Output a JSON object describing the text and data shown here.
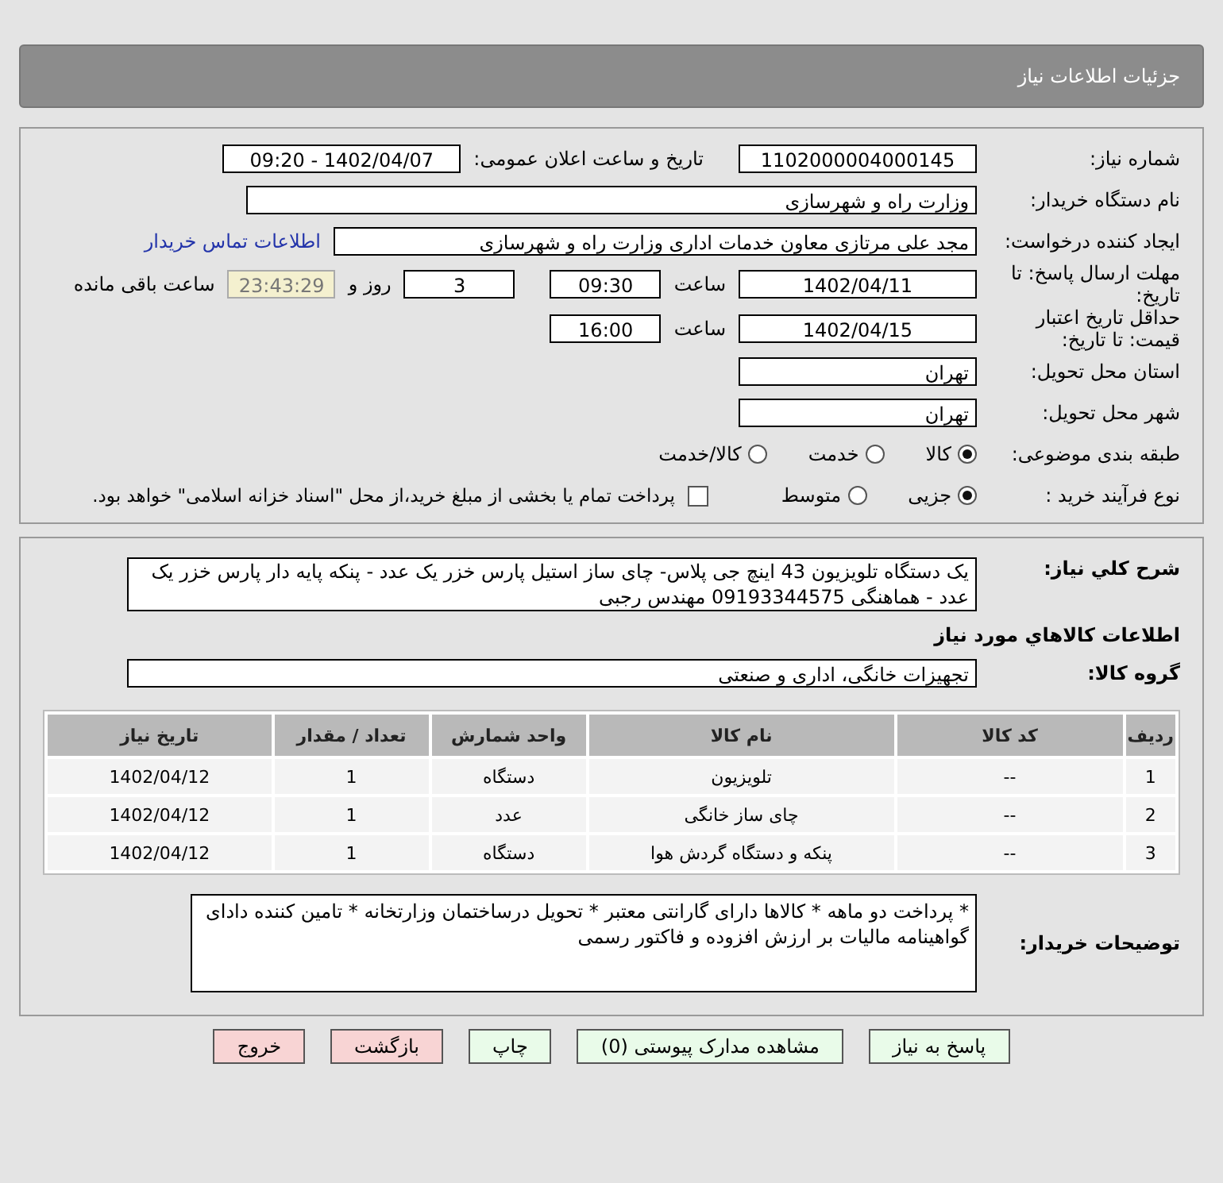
{
  "page_title": "جزئیات اطلاعات نیاز",
  "form": {
    "need_number": {
      "label": "شماره نیاز:",
      "value": "1102000004000145"
    },
    "announce": {
      "label": "تاریخ و ساعت اعلان عمومی:",
      "value": "1402/04/07 - 09:20"
    },
    "buyer": {
      "label": "نام دستگاه خریدار:",
      "value": "وزارت راه و شهرسازی"
    },
    "requester": {
      "label": "ایجاد کننده درخواست:",
      "value": "مجد علی  مرتازی معاون خدمات اداری وزارت راه و شهرسازی",
      "link": "اطلاعات تماس خریدار"
    },
    "deadline": {
      "label": "مهلت ارسال پاسخ: تا تاریخ:",
      "date": "1402/04/11",
      "time_label": "ساعت",
      "time": "09:30",
      "days": "3",
      "days_label": "روز و",
      "remaining": "23:43:29",
      "remaining_label": "ساعت باقی مانده"
    },
    "validity": {
      "label": "حداقل تاریخ اعتبار قیمت: تا تاریخ:",
      "date": "1402/04/15",
      "time_label": "ساعت",
      "time": "16:00"
    },
    "province": {
      "label": "استان محل تحویل:",
      "value": "تهران"
    },
    "city": {
      "label": "شهر محل تحویل:",
      "value": "تهران"
    },
    "category": {
      "label": "طبقه بندی موضوعی:",
      "options": [
        {
          "label": "کالا",
          "selected": true
        },
        {
          "label": "خدمت",
          "selected": false
        },
        {
          "label": "کالا/خدمت",
          "selected": false
        }
      ]
    },
    "process": {
      "label": "نوع فرآیند خرید :",
      "options": [
        {
          "label": "جزیی",
          "selected": true
        },
        {
          "label": "متوسط",
          "selected": false
        }
      ],
      "payment": {
        "checked": false,
        "text": "پرداخت تمام یا بخشی از مبلغ خرید،از محل \"اسناد خزانه اسلامی\" خواهد بود."
      }
    }
  },
  "summary": {
    "description": {
      "label": "شرح کلي نیاز:",
      "value": "یک دستگاه تلویزیون 43 اینچ جی پلاس- چای ساز استیل پارس خزر یک عدد - پنکه پایه دار پارس خزر یک عدد - هماهنگی 09193344575 مهندس رجبی"
    },
    "goods_heading": "اطلاعات کالاهاي مورد نیاز",
    "group": {
      "label": "گروه کالا:",
      "value": "تجهیزات خانگی، اداری و صنعتی"
    },
    "table": {
      "columns": [
        "ردیف",
        "کد کالا",
        "نام کالا",
        "واحد شمارش",
        "تعداد / مقدار",
        "تاریخ نیاز"
      ],
      "rows": [
        [
          "1",
          "--",
          "تلویزیون",
          "دستگاه",
          "1",
          "1402/04/12"
        ],
        [
          "2",
          "--",
          "چای ساز خانگی",
          "عدد",
          "1",
          "1402/04/12"
        ],
        [
          "3",
          "--",
          "پنکه و دستگاه گردش هوا",
          "دستگاه",
          "1",
          "1402/04/12"
        ]
      ]
    },
    "notes": {
      "label": "توضیحات خریدار:",
      "value": "* پرداخت دو ماهه * کالاها دارای گارانتی معتبر * تحویل درساختمان وزارتخانه * تامین کننده دادای گواهینامه مالیات بر ارزش افزوده و فاکتور رسمی"
    }
  },
  "buttons": [
    {
      "label": "پاسخ به نیاز",
      "kind": "action"
    },
    {
      "label": "مشاهده مدارک پیوستی (0)",
      "kind": "action"
    },
    {
      "label": "چاپ",
      "kind": "action"
    },
    {
      "label": "بازگشت",
      "kind": "exit"
    },
    {
      "label": "خروج",
      "kind": "exit"
    }
  ]
}
